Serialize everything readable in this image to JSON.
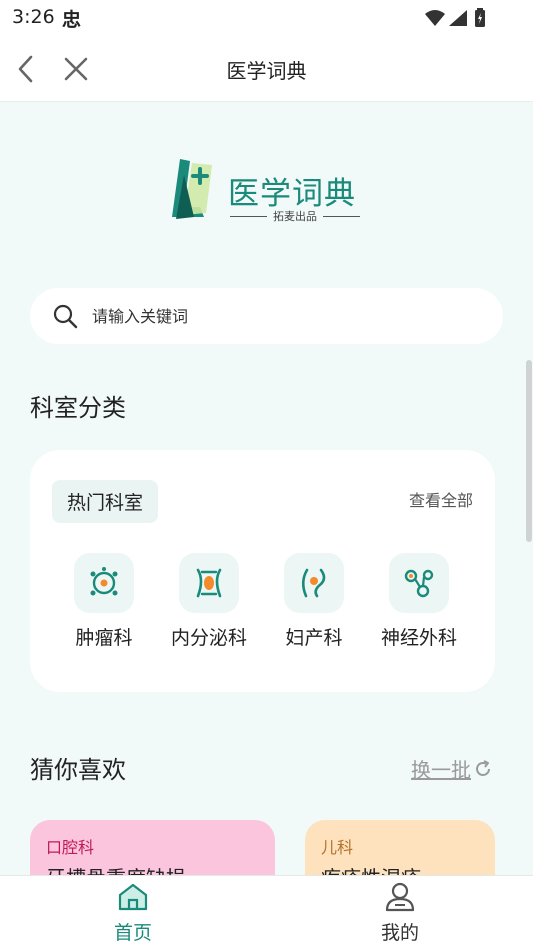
{
  "status": {
    "time": "3:26",
    "sim_glyph": "忠"
  },
  "navbar": {
    "title": "医学词典"
  },
  "logo": {
    "name": "医学词典",
    "tagline": "拓麦出品"
  },
  "search": {
    "placeholder": "请输入关键词"
  },
  "departments": {
    "title": "科室分类",
    "hot_label": "热门科室",
    "view_all": "查看全部",
    "items": [
      {
        "label": "肿瘤科",
        "icon": "tumor-icon"
      },
      {
        "label": "内分泌科",
        "icon": "endocrine-icon"
      },
      {
        "label": "妇产科",
        "icon": "obstetrics-icon"
      },
      {
        "label": "神经外科",
        "icon": "neurosurgery-icon"
      }
    ]
  },
  "recommend": {
    "title": "猜你喜欢",
    "refresh": "换一批",
    "cards": [
      {
        "category": "口腔科",
        "title": "牙槽骨重度缺损",
        "bg": "#fbc6dd",
        "accent": "#c2185b"
      },
      {
        "category": "儿科",
        "title": "疱疹性湿疹",
        "bg": "#fde2bd",
        "accent": "#b5712a"
      }
    ]
  },
  "tabs": [
    {
      "label": "首页",
      "icon": "home-icon",
      "active": true
    },
    {
      "label": "我的",
      "icon": "profile-icon",
      "active": false
    }
  ],
  "colors": {
    "accent": "#1a8a7b",
    "background": "#f2f9f9"
  }
}
